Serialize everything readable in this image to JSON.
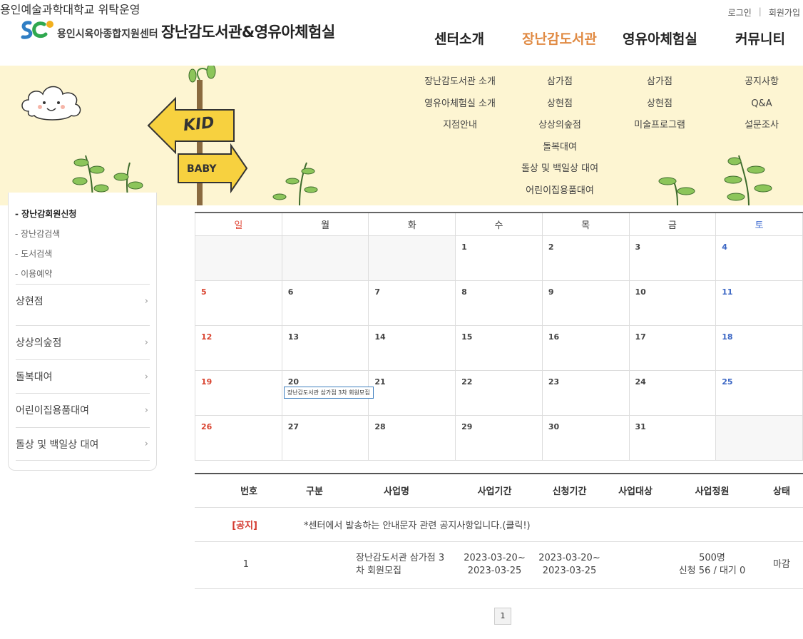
{
  "header": {
    "logo_small": "용인예술과학대학교 위탁운영",
    "logo_center": "용인시육아종합지원센터",
    "site_title": "장난감도서관&영유아체험실",
    "top_links": {
      "login": "로그인",
      "sep": "|",
      "signup": "회원가입"
    },
    "gnb": [
      "센터소개",
      "장난감도서관",
      "영유아체험실",
      "커뮤니티"
    ]
  },
  "banner": {
    "sign_kid": "KID",
    "sign_baby": "BABY",
    "menu_columns": [
      [
        "장난감도서관 소개",
        "영유아체험실 소개",
        "지점안내"
      ],
      [
        "삼가점",
        "상현점",
        "상상의숲점",
        "돌복대여",
        "돌상 및 백일상 대여",
        "어린이집용품대여"
      ],
      [
        "삼가점",
        "상현점",
        "미술프로그램"
      ],
      [
        "공지사항",
        "Q&A",
        "설문조사"
      ]
    ]
  },
  "sidebar": {
    "sub_items": [
      "- 장난감회원신청",
      "- 장난감검색",
      "- 도서검색",
      "- 이용예약"
    ],
    "items": [
      "상현점",
      "상상의숲점",
      "돌복대여",
      "어린이집용품대여",
      "돌상 및 백일상 대여"
    ],
    "chevron": "›"
  },
  "calendar": {
    "weekdays": [
      "일",
      "월",
      "화",
      "수",
      "목",
      "금",
      "토"
    ],
    "weeks": [
      [
        "",
        "",
        "",
        "1",
        "2",
        "3",
        "4"
      ],
      [
        "5",
        "6",
        "7",
        "8",
        "9",
        "10",
        "11"
      ],
      [
        "12",
        "13",
        "14",
        "15",
        "16",
        "17",
        "18"
      ],
      [
        "19",
        "20",
        "21",
        "22",
        "23",
        "24",
        "25"
      ],
      [
        "26",
        "27",
        "28",
        "29",
        "30",
        "31",
        ""
      ]
    ],
    "event": {
      "day": "20",
      "text": "장난감도서관 삼가점 3차 회원모집"
    }
  },
  "program_list": {
    "headers": [
      "번호",
      "구분",
      "사업명",
      "사업기간",
      "신청기간",
      "사업대상",
      "사업정원",
      "상태"
    ],
    "notice": {
      "tag": "[공지]",
      "text": "*센터에서 발송하는 안내문자 관련 공지사항입니다.(클릭!)"
    },
    "rows": [
      {
        "no": "1",
        "category": "",
        "name": "장난감도서관 삼가점 3차 회원모집",
        "period": "2023-03-20~ 2023-03-25",
        "apply": "2023-03-20~ 2023-03-25",
        "target": "",
        "quota": "500명",
        "quota_detail": "신청 56 / 대기 0",
        "status": "마감"
      }
    ]
  },
  "pagination": {
    "current": "1"
  }
}
